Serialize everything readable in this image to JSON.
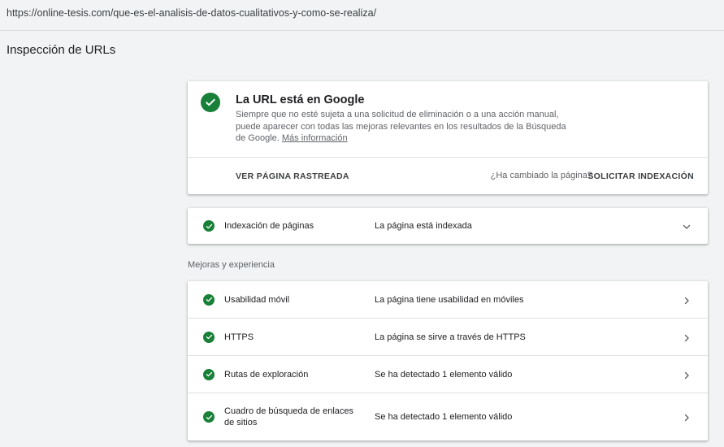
{
  "url_bar": {
    "url": "https://online-tesis.com/que-es-el-analisis-de-datos-cualitativos-y-como-se-realiza/"
  },
  "page": {
    "title": "Inspección de URLs"
  },
  "result_card": {
    "title": "La URL está en Google",
    "description": "Siempre que no esté sujeta a una solicitud de eliminación o a una acción manual, puede aparecer con todas las mejoras relevantes en los resultados de la Búsqueda de Google.",
    "more_info_link": "Más información",
    "view_crawled_label": "VER PÁGINA RASTREADA",
    "changed_question": "¿Ha cambiado la página?",
    "request_indexing_label": "SOLICITAR INDEXACIÓN"
  },
  "indexing": {
    "label": "Indexación de páginas",
    "status": "La página está indexada",
    "icon": "chevron-down-icon"
  },
  "enhancements": {
    "section_label": "Mejoras y experiencia",
    "items": [
      {
        "label": "Usabilidad móvil",
        "status": "La página tiene usabilidad en móviles"
      },
      {
        "label": "HTTPS",
        "status": "La página se sirve a través de HTTPS"
      },
      {
        "label": "Rutas de exploración",
        "status": "Se ha detectado 1 elemento válido"
      },
      {
        "label": "Cuadro de búsqueda de enlaces de sitios",
        "status": "Se ha detectado 1 elemento válido"
      }
    ]
  },
  "colors": {
    "success": "#188038",
    "background": "#f1f3f4",
    "card": "#ffffff"
  }
}
